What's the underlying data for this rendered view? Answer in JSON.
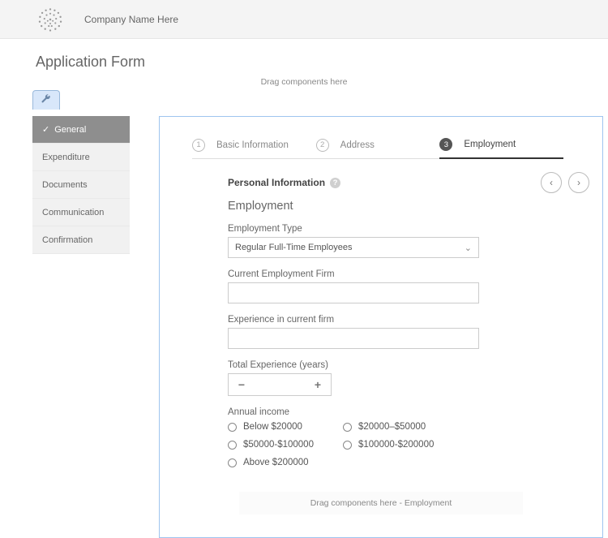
{
  "header": {
    "company_name": "Company Name Here"
  },
  "page_title": "Application Form",
  "drag_hint": "Drag components here",
  "sidebar": {
    "items": [
      {
        "label": "General",
        "active": true,
        "checked": true
      },
      {
        "label": "Expenditure"
      },
      {
        "label": "Documents"
      },
      {
        "label": "Communication"
      },
      {
        "label": "Confirmation"
      }
    ]
  },
  "stepper": {
    "steps": [
      {
        "num": "1",
        "label": "Basic Information"
      },
      {
        "num": "2",
        "label": "Address"
      },
      {
        "num": "3",
        "label": "Employment",
        "active": true
      }
    ]
  },
  "section": {
    "title": "Personal Information",
    "sub_heading": "Employment"
  },
  "form": {
    "employment_type": {
      "label": "Employment Type",
      "value": "Regular Full-Time Employees"
    },
    "current_firm": {
      "label": "Current Employment Firm",
      "value": ""
    },
    "experience_current": {
      "label": "Experience in current firm",
      "value": ""
    },
    "total_experience": {
      "label": "Total Experience (years)",
      "value": ""
    },
    "annual_income": {
      "label": "Annual income",
      "options": [
        "Below $20000",
        "$20000–$50000",
        "$50000-$100000",
        "$100000-$200000",
        "Above $200000"
      ]
    }
  },
  "drop_slot": "Drag components here - Employment",
  "glyphs": {
    "minus": "−",
    "plus": "+",
    "chev_down": "⌄",
    "chev_left": "‹",
    "chev_right": "›",
    "check": "✓",
    "question": "?"
  }
}
